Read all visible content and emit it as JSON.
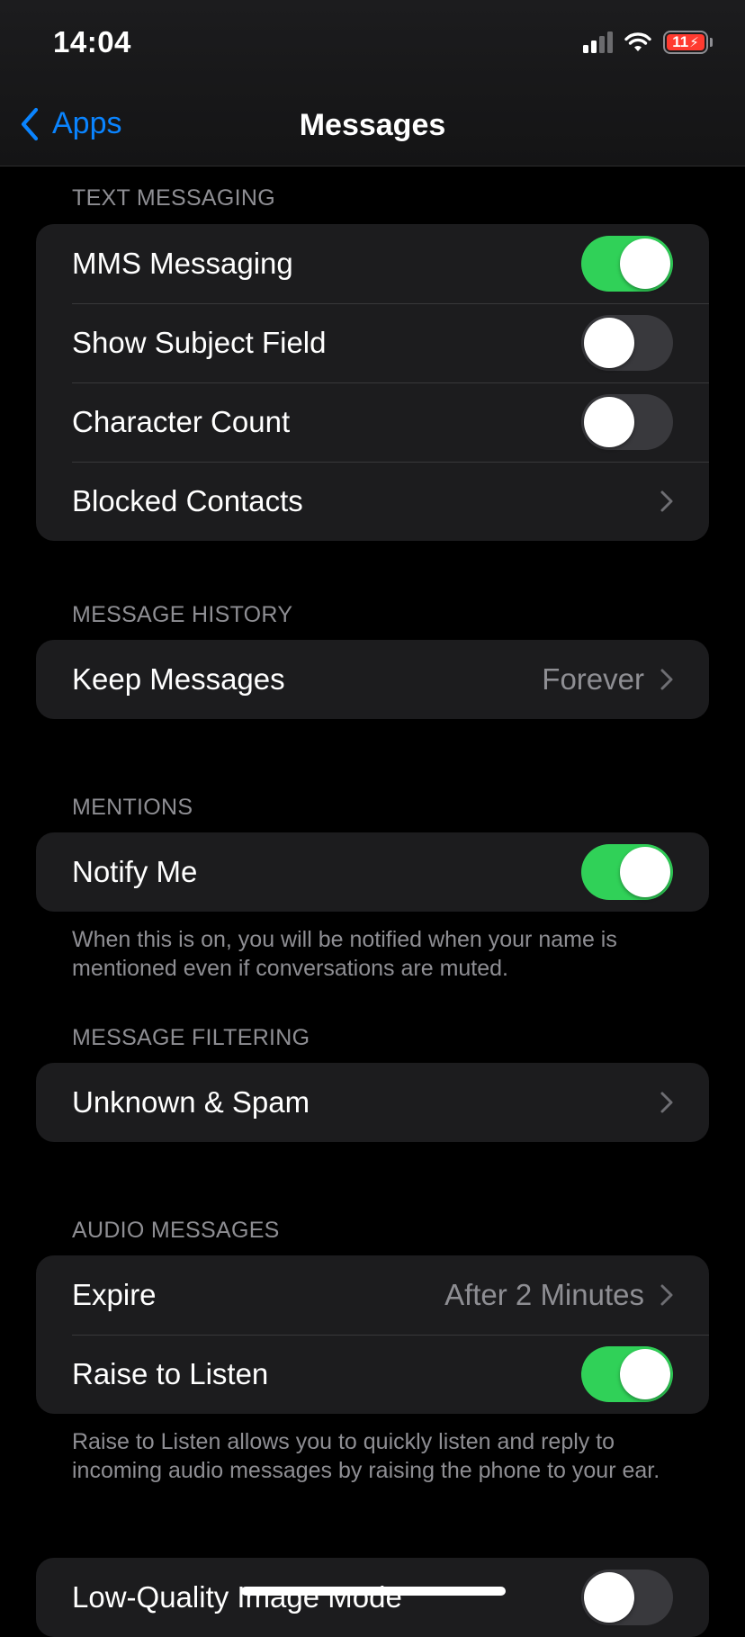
{
  "status_bar": {
    "time": "14:04",
    "battery_level": "11",
    "icons": [
      "cellular-signal-icon",
      "wifi-icon",
      "battery-charging-icon"
    ]
  },
  "nav": {
    "back_label": "Apps",
    "title": "Messages"
  },
  "colors": {
    "accent": "#0a84ff",
    "toggle_on": "#30d158",
    "toggle_off": "#39393d",
    "group_bg": "#1c1c1e",
    "secondary_text": "#8e8e93",
    "battery_low": "#ff3b30"
  },
  "sections": {
    "text_messaging": {
      "header": "TEXT MESSAGING",
      "rows": [
        {
          "label": "MMS Messaging",
          "control": "toggle",
          "on": true
        },
        {
          "label": "Show Subject Field",
          "control": "toggle",
          "on": false
        },
        {
          "label": "Character Count",
          "control": "toggle",
          "on": false
        },
        {
          "label": "Blocked Contacts",
          "control": "chevron"
        }
      ]
    },
    "message_history": {
      "header": "MESSAGE HISTORY",
      "rows": [
        {
          "label": "Keep Messages",
          "value": "Forever",
          "control": "chevron"
        }
      ]
    },
    "mentions": {
      "header": "MENTIONS",
      "rows": [
        {
          "label": "Notify Me",
          "control": "toggle",
          "on": true
        }
      ],
      "footer": "When this is on, you will be notified when your name is mentioned even if conversations are muted."
    },
    "message_filtering": {
      "header": "MESSAGE FILTERING",
      "rows": [
        {
          "label": "Unknown & Spam",
          "control": "chevron"
        }
      ]
    },
    "audio_messages": {
      "header": "AUDIO MESSAGES",
      "rows": [
        {
          "label": "Expire",
          "value": "After 2 Minutes",
          "control": "chevron"
        },
        {
          "label": "Raise to Listen",
          "control": "toggle",
          "on": true
        }
      ],
      "footer": "Raise to Listen allows you to quickly listen and reply to incoming audio messages by raising the phone to your ear."
    },
    "low_quality": {
      "rows": [
        {
          "label": "Low-Quality Image Mode",
          "control": "toggle",
          "on": false
        }
      ]
    }
  }
}
